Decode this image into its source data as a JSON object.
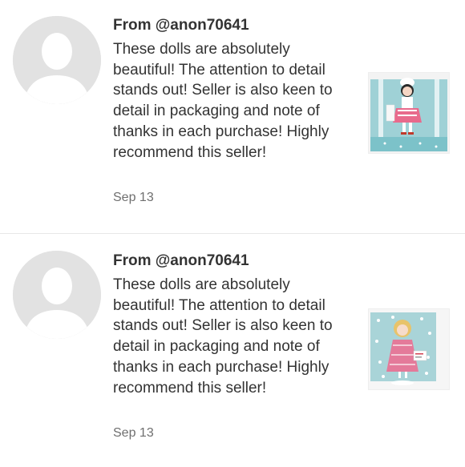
{
  "reviews": [
    {
      "author": "From @anon70641",
      "comment": "These dolls are absolutely beautiful! The attention to detail stands out! Seller is also keen to detail in packaging and note of thanks in each purchase! Highly recommend this seller!",
      "date": "Sep 13",
      "avatar_icon": "default-user-silhouette",
      "thumbnail": "doll-in-striped-box"
    },
    {
      "author": "From @anon70641",
      "comment": "These dolls are absolutely beautiful! The attention to detail stands out! Seller is also keen to detail in packaging and note of thanks in each purchase! Highly recommend this seller!",
      "date": "Sep 13",
      "avatar_icon": "default-user-silhouette",
      "thumbnail": "doll-in-pink-dress"
    }
  ],
  "colors": {
    "text": "#333333",
    "muted": "#6f6f6f",
    "avatar_bg": "#e2e2e2",
    "divider": "#e8e8e8"
  }
}
